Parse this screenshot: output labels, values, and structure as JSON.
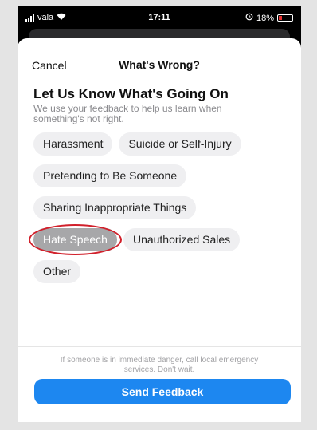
{
  "status_bar": {
    "carrier": "vala",
    "time": "17:11",
    "battery": "18%"
  },
  "nav": {
    "cancel_label": "Cancel",
    "title": "What's Wrong?"
  },
  "content": {
    "heading": "Let Us Know What's Going On",
    "subtitle": "We use your feedback to help us learn when something's not right."
  },
  "options": [
    {
      "label": "Harassment",
      "selected": false
    },
    {
      "label": "Suicide or Self-Injury",
      "selected": false
    },
    {
      "label": "Pretending to Be Someone",
      "selected": false
    },
    {
      "label": "Sharing Inappropriate Things",
      "selected": false
    },
    {
      "label": "Hate Speech",
      "selected": true
    },
    {
      "label": "Unauthorized Sales",
      "selected": false
    },
    {
      "label": "Other",
      "selected": false
    }
  ],
  "footer": {
    "emergency_note": "If someone is in immediate danger, call local emergency services. Don't wait.",
    "send_label": "Send Feedback"
  },
  "colors": {
    "accent": "#1d87f0",
    "selected_chip": "#a7a7a9",
    "annotation_circle": "#d1202b"
  }
}
